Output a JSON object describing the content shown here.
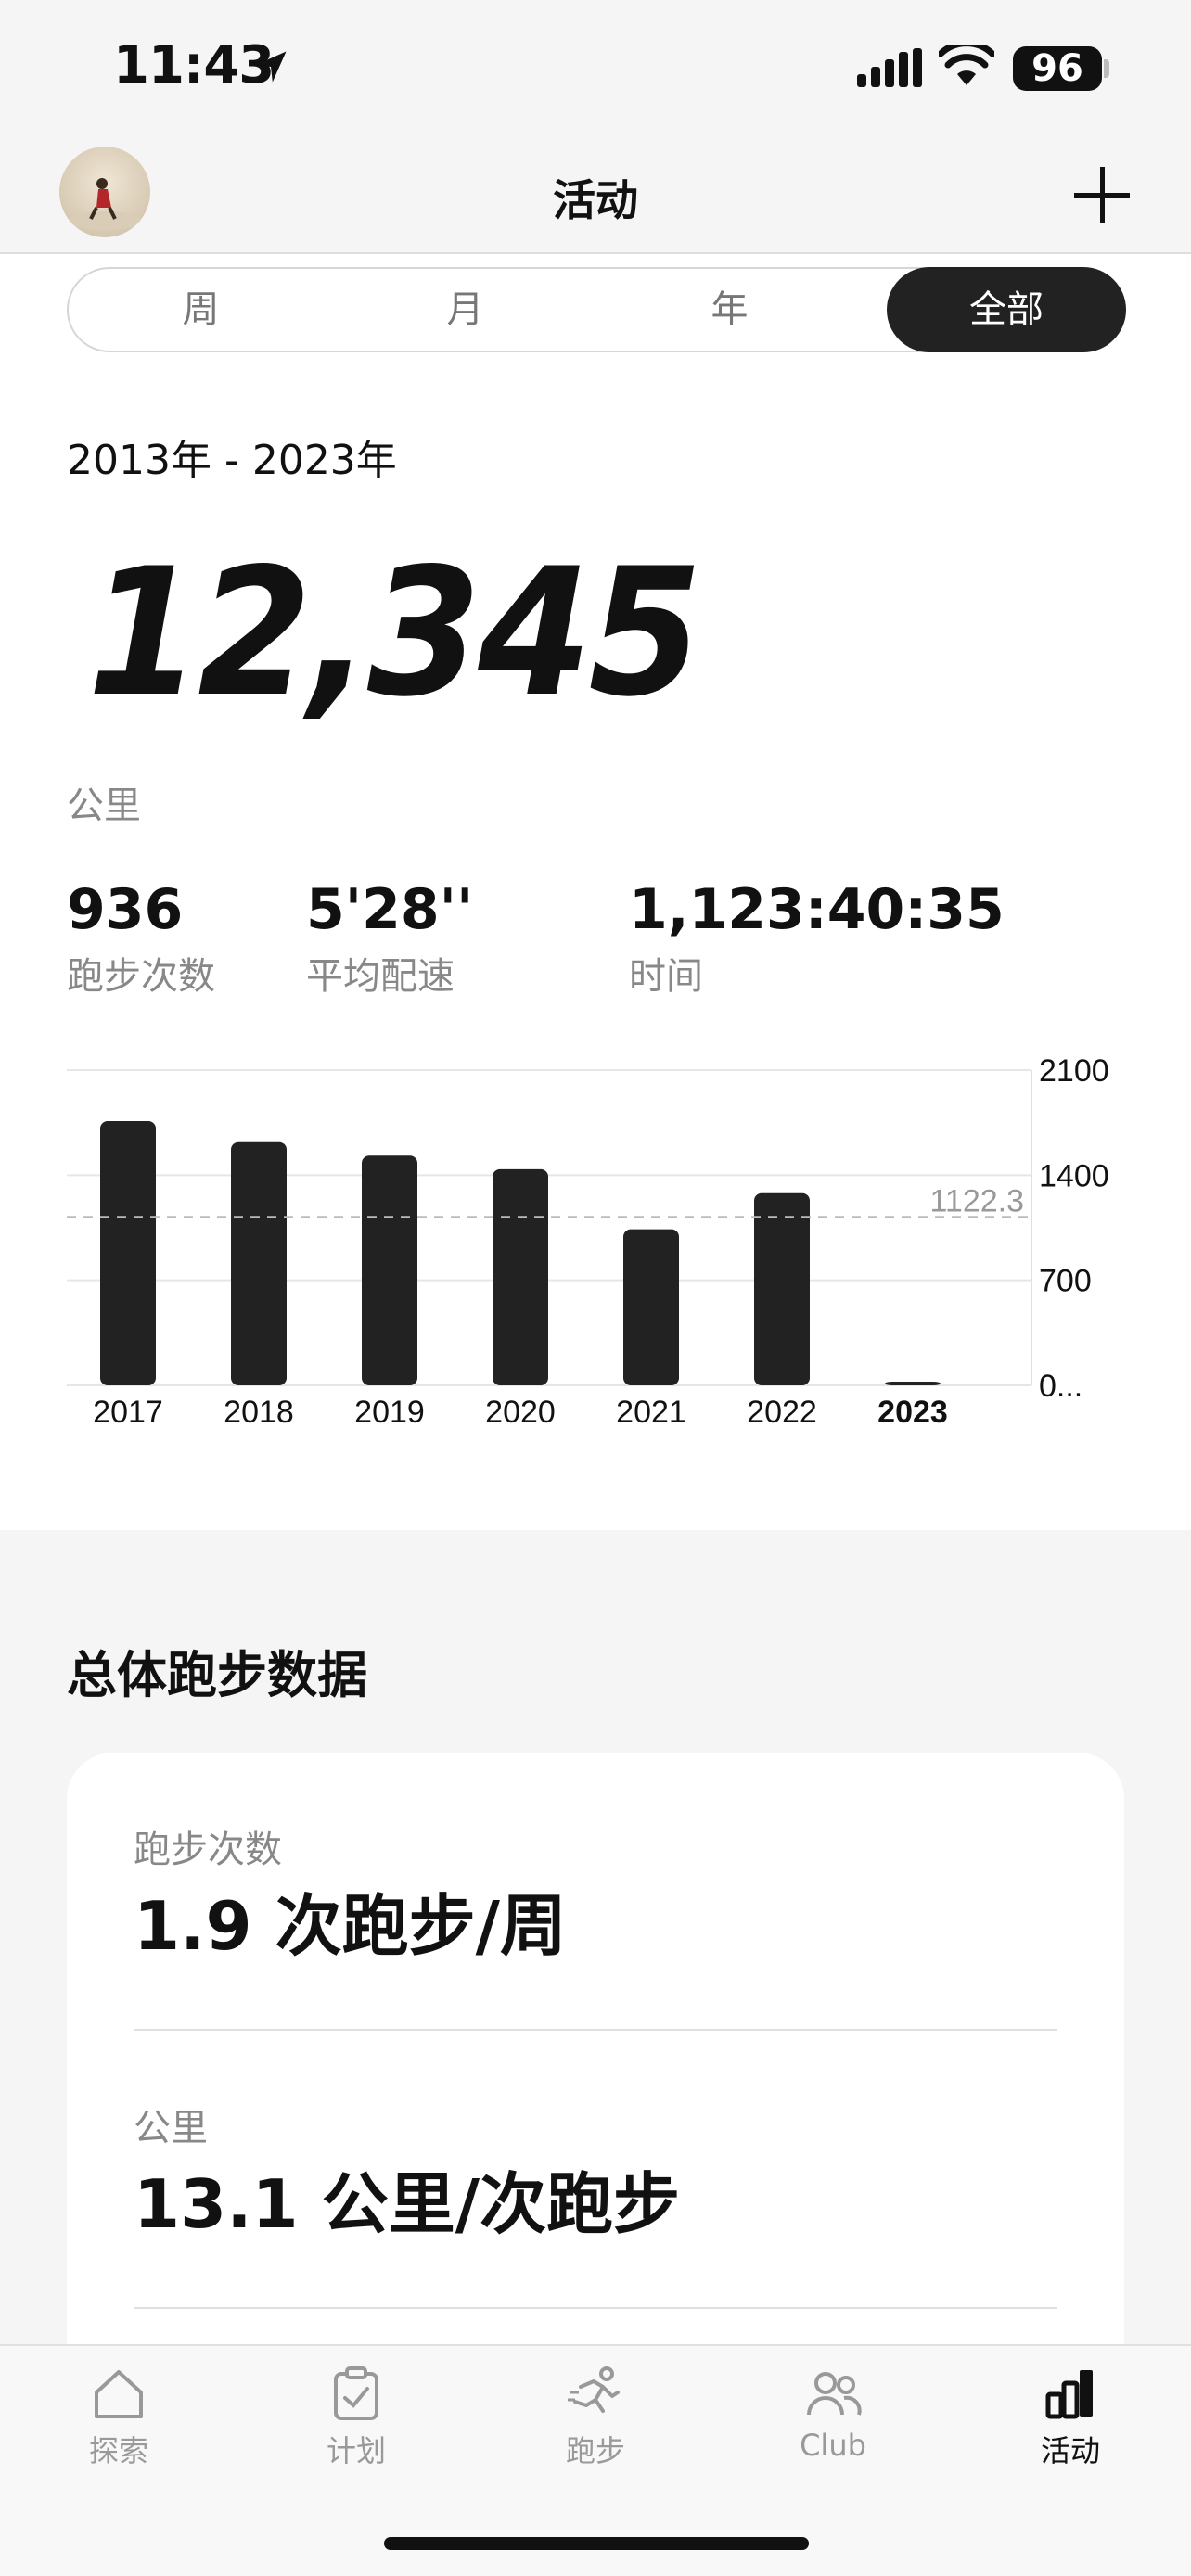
{
  "status_bar": {
    "time": "11:43",
    "battery": "96"
  },
  "header": {
    "title": "活动"
  },
  "segments": [
    "周",
    "月",
    "年",
    "全部"
  ],
  "summary": {
    "range": "2013年 - 2023年",
    "total_distance": "12,345",
    "unit": "公里",
    "stats": [
      {
        "value": "936",
        "label": "跑步次数"
      },
      {
        "value": "5'28''",
        "label": "平均配速"
      },
      {
        "value": "1,123:40:35",
        "label": "时间"
      }
    ]
  },
  "chart_data": {
    "type": "bar",
    "categories": [
      "2017",
      "2018",
      "2019",
      "2020",
      "2021",
      "2022",
      "2023"
    ],
    "values": [
      1760,
      1620,
      1530,
      1440,
      1040,
      1280,
      20
    ],
    "y_tick_labels": [
      "2100",
      "1400",
      "700",
      "0..."
    ],
    "y_ticks": [
      2100,
      1400,
      700,
      0
    ],
    "ylim": [
      0,
      2100
    ],
    "average_line": {
      "value": 1122.3,
      "label": "1122.3"
    },
    "highlighted_category": "2023",
    "bar_color": "#222222",
    "grid": true
  },
  "overall": {
    "title": "总体跑步数据",
    "rows": [
      {
        "label": "跑步次数",
        "value": "1.9 次跑步/周"
      },
      {
        "label": "公里",
        "value": "13.1 公里/次跑步"
      }
    ]
  },
  "tab_bar": {
    "items": [
      {
        "label": "探索",
        "icon": "home-icon"
      },
      {
        "label": "计划",
        "icon": "clipboard-check-icon"
      },
      {
        "label": "跑步",
        "icon": "runner-icon"
      },
      {
        "label": "Club",
        "icon": "people-icon"
      },
      {
        "label": "活动",
        "icon": "bar-chart-icon"
      }
    ],
    "active": "活动"
  }
}
